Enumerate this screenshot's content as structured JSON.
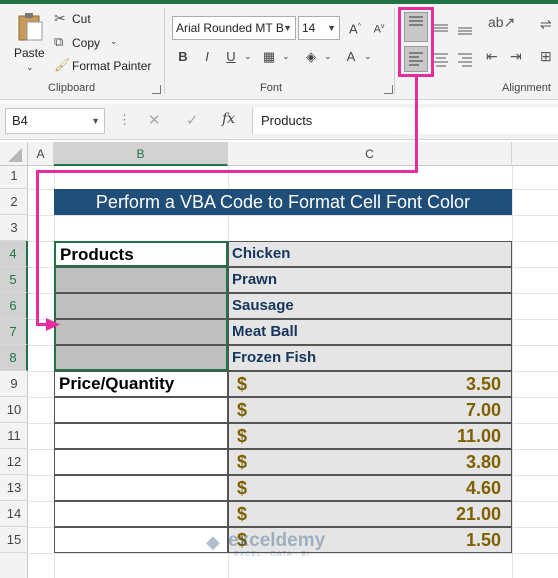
{
  "ribbon": {
    "clipboard": {
      "paste": "Paste",
      "cut": "Cut",
      "copy": "Copy",
      "format_painter": "Format Painter",
      "group_label": "Clipboard"
    },
    "font": {
      "family": "Arial Rounded MT B",
      "size": "14",
      "bold": "B",
      "italic": "I",
      "underline": "U",
      "font_color": "A",
      "highlight": "A",
      "group_label": "Font"
    },
    "alignment": {
      "group_label": "Alignment"
    }
  },
  "formula_bar": {
    "name_box": "B4",
    "fx": "fx",
    "cancel": "✕",
    "enter": "✓",
    "content": "Products"
  },
  "columns": [
    "A",
    "B",
    "C"
  ],
  "rows": [
    "1",
    "2",
    "3",
    "4",
    "5",
    "6",
    "7",
    "8",
    "9",
    "10",
    "11",
    "12",
    "13",
    "14",
    "15"
  ],
  "sheet": {
    "title": "Perform a VBA Code to Format Cell Font Color",
    "products_label": "Products",
    "products": [
      "Chicken",
      "Prawn",
      "Sausage",
      "Meat Ball",
      "Frozen Fish"
    ],
    "price_label": "Price/Quantity",
    "currency": "$",
    "prices": [
      "3.50",
      "7.00",
      "11.00",
      "3.80",
      "4.60",
      "21.00",
      "1.50"
    ]
  },
  "watermark": "exceldemy",
  "watermark_sub": "EXCEL · DATA · BI",
  "colors": {
    "title_bg": "#1f4e79",
    "product_text": "#16365c",
    "price_text": "#7f6000",
    "arrow": "#e52d9e"
  }
}
